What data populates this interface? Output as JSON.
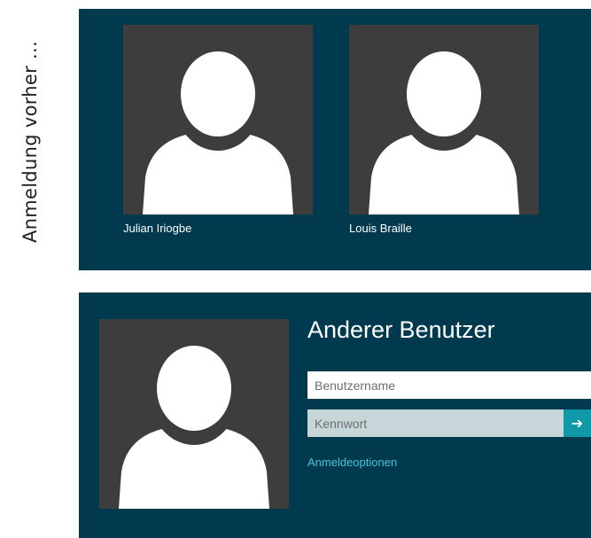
{
  "side_label": "Anmeldung vorher ...",
  "users": [
    {
      "name": "Julian Iriogbe"
    },
    {
      "name": "Louis Braille"
    }
  ],
  "other_user": {
    "title": "Anderer Benutzer",
    "username_placeholder": "Benutzername",
    "password_placeholder": "Kennwort",
    "submit_icon": "arrow-right-icon",
    "submit_glyph": "➔",
    "options_link": "Anmeldeoptionen"
  },
  "colors": {
    "panel": "#013a4f",
    "tile": "#3d3d3d",
    "accent": "#0f98a6",
    "link": "#46c2d8"
  }
}
